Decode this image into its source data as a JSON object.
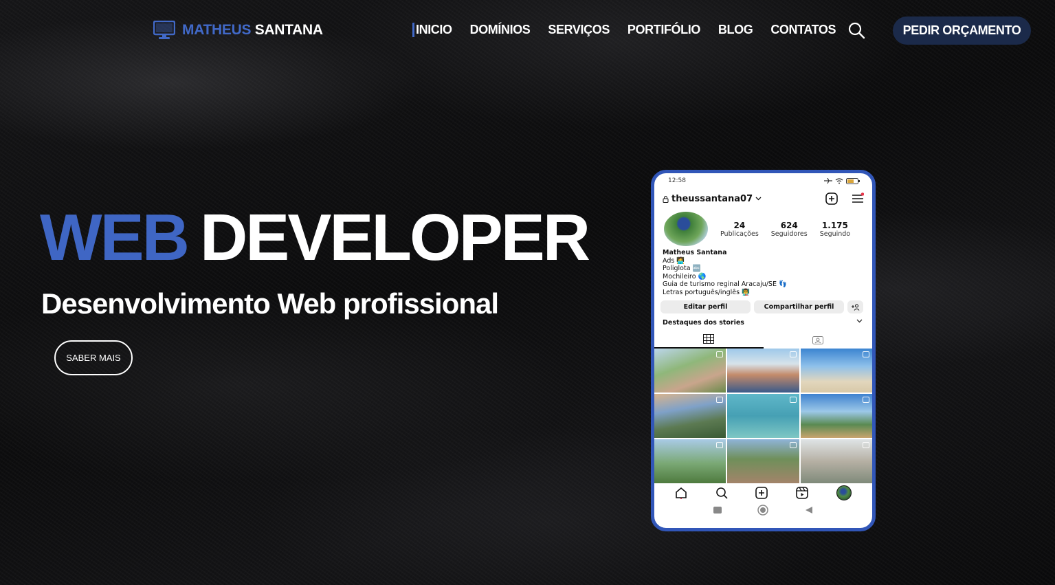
{
  "header": {
    "logo": {
      "first": "MATHEUS",
      "last": "SANTANA",
      "icon": "monitor-icon"
    },
    "nav": [
      {
        "label": "INICIO",
        "active": true
      },
      {
        "label": "DOMÍNIOS",
        "active": false
      },
      {
        "label": "SERVIÇOS",
        "active": false
      },
      {
        "label": "PORTIFÓLIO",
        "active": false
      },
      {
        "label": "BLOG",
        "active": false
      },
      {
        "label": "CONTATOS",
        "active": false
      }
    ],
    "search_icon": "search-icon",
    "cta_label": "PEDIR ORÇAMENTO"
  },
  "hero": {
    "title_accent": "WEB",
    "title_main": "DEVELOPER",
    "subtitle": "Desenvolvimento Web profissional",
    "button_label": "SABER MAIS"
  },
  "phone": {
    "time": "12:58",
    "username": "theussantana07",
    "stats": [
      {
        "value": "24",
        "label": "Publicações"
      },
      {
        "value": "624",
        "label": "Seguidores"
      },
      {
        "value": "1.175",
        "label": "Seguindo"
      }
    ],
    "bio": {
      "name": "Matheus Santana",
      "lines": [
        "Ads 🧑‍💻",
        "Poliglota 🔤",
        "Mochileiro 🌎",
        "Guia de turismo reginal Aracaju/SE 👣",
        "Letras português/inglês 👨‍🏫"
      ]
    },
    "buttons": {
      "edit": "Editar perfil",
      "share": "Compartilhar perfil"
    },
    "highlights_label": "Destaques dos stories"
  },
  "colors": {
    "accent": "#3f66c4",
    "cta_bg": "#1b2a4a",
    "phone_border": "#3156b8"
  }
}
